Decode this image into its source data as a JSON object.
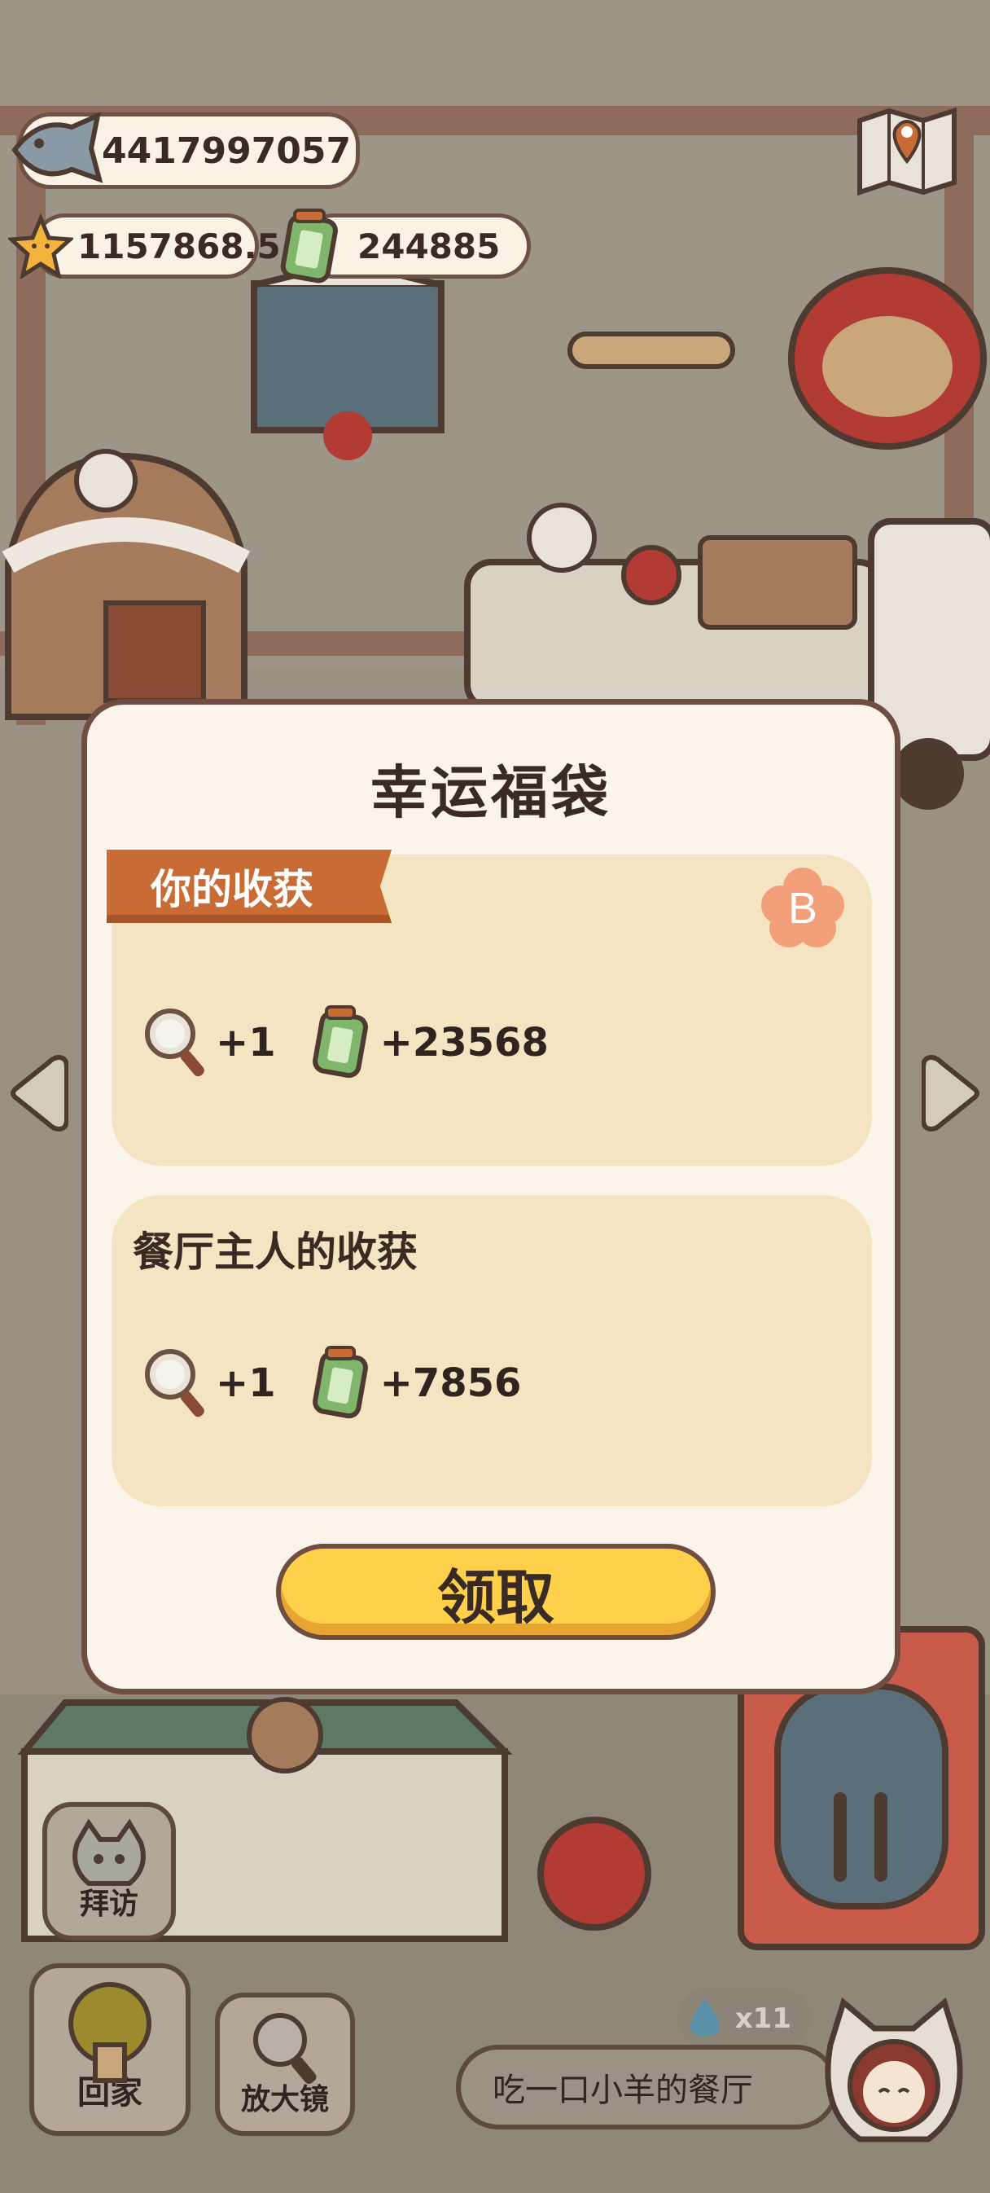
{
  "resources": {
    "fish": {
      "value": "4417997057",
      "icon": "fish-icon"
    },
    "star": {
      "value": "1157868.5",
      "icon": "star-icon"
    },
    "ticket": {
      "value": "244885",
      "icon": "ticket-icon"
    }
  },
  "modal": {
    "title": "幸运福袋",
    "your_rewards": {
      "label": "你的收获",
      "grade": "B",
      "items": [
        {
          "icon": "magnifier-icon",
          "amount": "+1"
        },
        {
          "icon": "ticket-icon",
          "amount": "+23568"
        }
      ]
    },
    "owner_rewards": {
      "label": "餐厅主人的收获",
      "items": [
        {
          "icon": "magnifier-icon",
          "amount": "+1"
        },
        {
          "icon": "ticket-icon",
          "amount": "+7856"
        }
      ]
    },
    "claim_label": "领取"
  },
  "bottom": {
    "visit_label": "拜访",
    "home_label": "回家",
    "magnifier_label": "放大镜",
    "water_count": "x11",
    "restaurant_name": "吃一口小羊的餐厅"
  },
  "colors": {
    "ribbon": "#c96b35",
    "card": "#f4e4c1",
    "button": "#ffd14a",
    "badge": "#f3a07a",
    "overlay_dim": "#9a9184"
  }
}
